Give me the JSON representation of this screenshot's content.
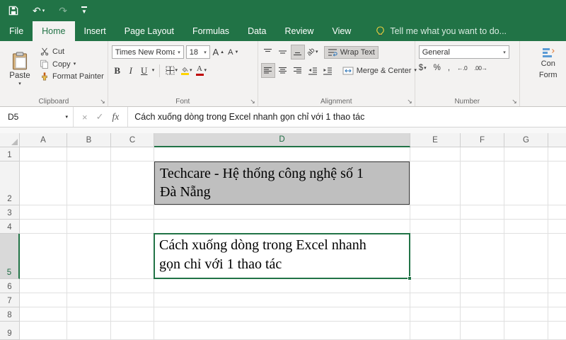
{
  "app": {
    "colors": {
      "accent": "#217346",
      "d2_fill": "#bfbfbf",
      "font_color_bar": "#c00000",
      "fill_color_bar": "#ffd400"
    },
    "icon_names": [
      "save-icon",
      "undo-icon",
      "redo-icon",
      "customize-quick-access-icon",
      "lightbulb-icon",
      "paste-icon",
      "scissors-icon",
      "copy-icon",
      "format-painter-icon",
      "increase-font-icon",
      "decrease-font-icon",
      "borders-icon",
      "fill-color-icon",
      "font-color-icon",
      "align-top-icon",
      "align-middle-icon",
      "align-bottom-icon",
      "orientation-icon",
      "align-left-icon",
      "align-center-icon",
      "align-right-icon",
      "decrease-indent-icon",
      "increase-indent-icon",
      "wrap-text-icon",
      "merge-center-icon",
      "accounting-icon",
      "increase-decimal-icon",
      "decrease-decimal-icon",
      "conditional-formatting-icon",
      "select-all-corner-icon",
      "fill-handle"
    ]
  },
  "tabs": {
    "items": [
      {
        "label": "File",
        "active": false
      },
      {
        "label": "Home",
        "active": true
      },
      {
        "label": "Insert",
        "active": false
      },
      {
        "label": "Page Layout",
        "active": false
      },
      {
        "label": "Formulas",
        "active": false
      },
      {
        "label": "Data",
        "active": false
      },
      {
        "label": "Review",
        "active": false
      },
      {
        "label": "View",
        "active": false
      }
    ],
    "tell_me": "Tell me what you want to do..."
  },
  "ribbon": {
    "clipboard": {
      "label": "Clipboard",
      "paste": "Paste",
      "cut": "Cut",
      "copy": "Copy",
      "format_painter": "Format Painter"
    },
    "font": {
      "label": "Font",
      "family": "Times New Roman",
      "size": "18",
      "bold": "B",
      "italic": "I",
      "underline": "U"
    },
    "alignment": {
      "label": "Alignment",
      "wrap_text": "Wrap Text",
      "merge_center": "Merge & Center"
    },
    "number": {
      "label": "Number",
      "format": "General",
      "currency": "$",
      "percent": "%",
      "comma": ",",
      "increase_decimal": "←.0",
      "decrease_decimal": ".00→"
    },
    "styles": {
      "partial_line1": "Con",
      "partial_line2": "Form"
    }
  },
  "formula_bar": {
    "name_box": "D5",
    "fx_label": "fx",
    "value": "Cách xuống dòng trong Excel nhanh gọn chỉ với 1 thao tác"
  },
  "sheet": {
    "columns": [
      "A",
      "B",
      "C",
      "D",
      "E",
      "F",
      "G",
      ""
    ],
    "rows": [
      "1",
      "2",
      "3",
      "4",
      "5",
      "6",
      "7",
      "8",
      "9"
    ],
    "selected_cell": "D5",
    "d2_text": "Techcare - Hệ thống công nghệ số 1\nĐà Nẵng",
    "d5_text": "Cách xuống dòng trong Excel nhanh\ngọn chỉ với 1 thao tác"
  }
}
